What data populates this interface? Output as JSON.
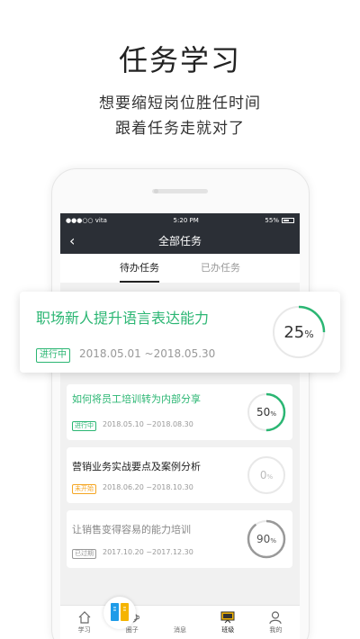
{
  "promo": {
    "title": "任务学习",
    "line1": "想要缩短岗位胜任时间",
    "line2": "跟着任务走就对了"
  },
  "statusbar": {
    "carrier": "●●●○○ vita",
    "time": "5:20 PM",
    "battery": "55%"
  },
  "navbar": {
    "title": "全部任务"
  },
  "tabs": [
    {
      "label": "待办任务",
      "active": true
    },
    {
      "label": "已办任务",
      "active": false
    }
  ],
  "featured": {
    "title": "职场新人提升语言表达能力",
    "status": "进行中",
    "date": "2018.05.01 ~2018.05.30",
    "progress": 25,
    "progress_label": "25",
    "unit": "%"
  },
  "tasks": [
    {
      "title": "如何将员工培训转为内部分享",
      "status": "进行中",
      "date": "2018.05.10 ~2018.08.30",
      "progress": 50,
      "progress_label": "50",
      "unit": "%"
    },
    {
      "title": "营销业务实战要点及案例分析",
      "status": "未开始",
      "date": "2018.06.20 ~2018.10.30",
      "progress": 0,
      "progress_label": "0",
      "unit": "%"
    },
    {
      "title": "让销售变得容易的能力培训",
      "status": "已过期",
      "date": "2017.10.20 ~2017.12.30",
      "progress": 90,
      "progress_label": "90",
      "unit": "%"
    }
  ],
  "bottom_nav": {
    "items": [
      {
        "label": "学习",
        "icon": "home-icon"
      },
      {
        "label": "圈子",
        "icon": "planet-icon"
      },
      {
        "label": "消息",
        "icon": "message-icon"
      },
      {
        "label": "班级",
        "icon": "class-icon"
      },
      {
        "label": "我的",
        "icon": "user-icon"
      }
    ]
  },
  "colors": {
    "green": "#2bb673",
    "orange": "#f5a623",
    "gray": "#999999",
    "dark": "#2b2f36"
  }
}
